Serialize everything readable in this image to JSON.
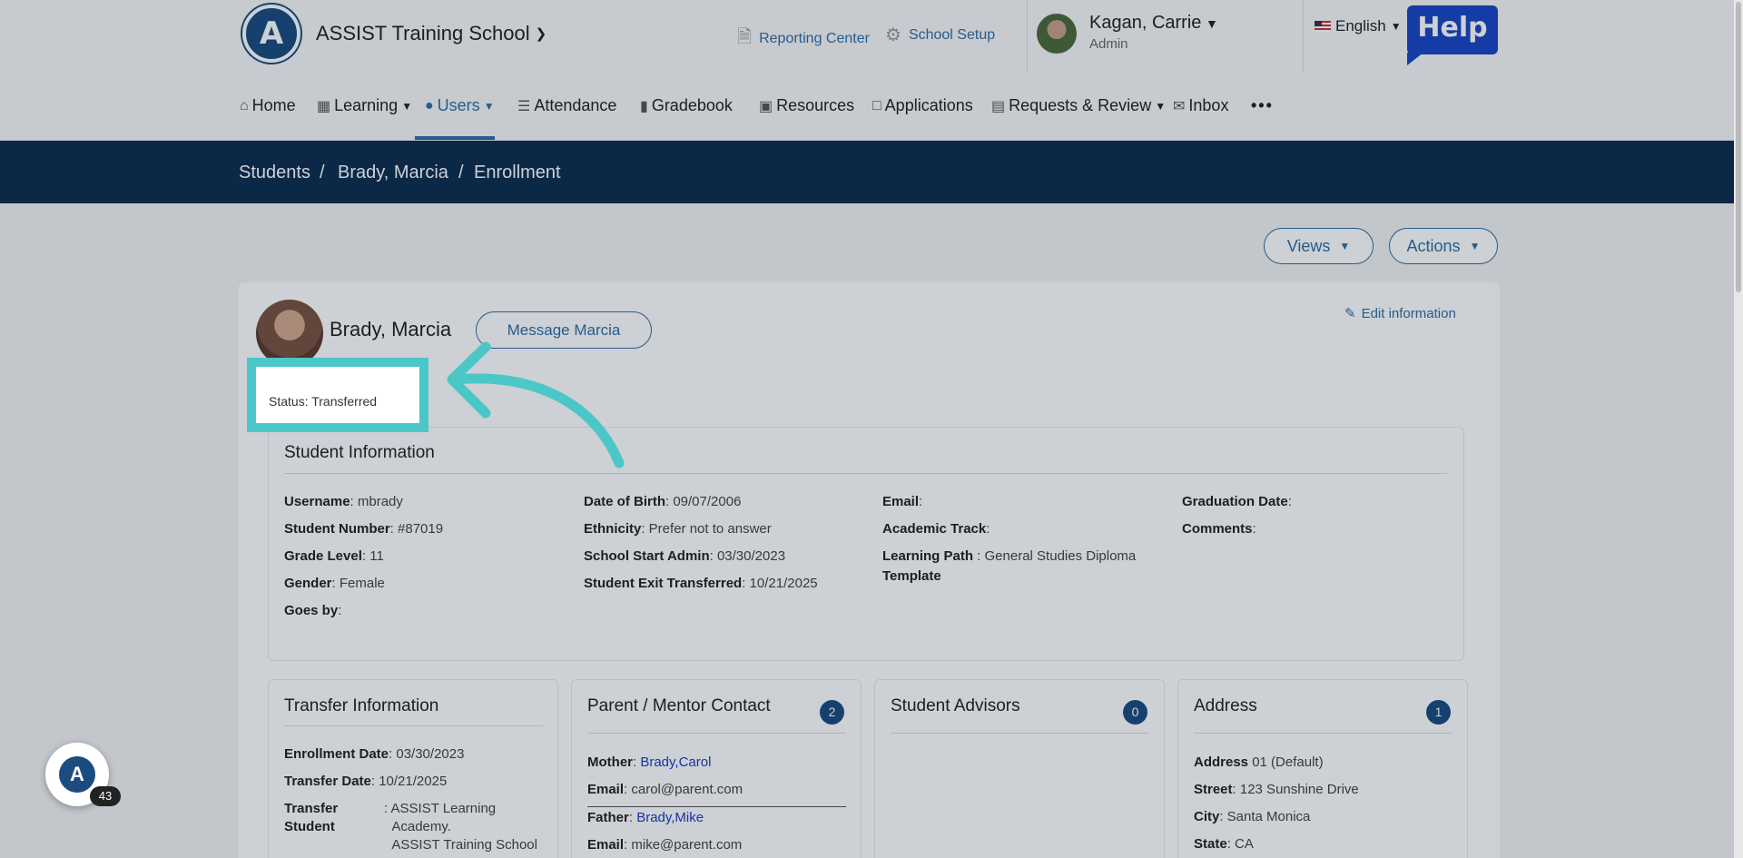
{
  "header": {
    "logo_letter": "A",
    "school_name": "ASSIST Training School",
    "reporting_center": "Reporting Center",
    "school_setup": "School Setup",
    "user_name": "Kagan, Carrie",
    "user_role": "Admin",
    "language": "English",
    "help": "Help"
  },
  "nav": {
    "items": [
      {
        "label": "Home",
        "icon": "home-icon"
      },
      {
        "label": "Learning",
        "icon": "learning-icon"
      },
      {
        "label": "Users",
        "icon": "user-icon"
      },
      {
        "label": "Attendance",
        "icon": "attendance-icon"
      },
      {
        "label": "Gradebook",
        "icon": "gradebook-icon"
      },
      {
        "label": "Resources",
        "icon": "resources-icon"
      },
      {
        "label": "Applications",
        "icon": "applications-icon"
      },
      {
        "label": "Requests & Review",
        "icon": "requests-icon"
      },
      {
        "label": "Inbox",
        "icon": "inbox-icon"
      }
    ],
    "more": "•••"
  },
  "breadcrumb": {
    "students": "Students",
    "sep": "/",
    "student": "Brady, Marcia",
    "page": "Enrollment"
  },
  "toolbar": {
    "views": "Views",
    "actions": "Actions"
  },
  "profile": {
    "name": "Brady, Marcia",
    "message_button": "Message Marcia",
    "edit": "Edit information",
    "status": "Status: Transferred"
  },
  "student_info": {
    "title": "Student Information",
    "col1": [
      {
        "k": "Username",
        "v": ": mbrady"
      },
      {
        "k": "Student Number",
        "v": ": #87019"
      },
      {
        "k": "Grade Level",
        "v": ": 11"
      },
      {
        "k": "Gender",
        "v": ": Female"
      },
      {
        "k": "Goes by",
        "v": ":"
      }
    ],
    "col2": [
      {
        "k": "Date of Birth",
        "v": ": 09/07/2006"
      },
      {
        "k": "Ethnicity",
        "v": ": Prefer not to answer"
      },
      {
        "k": "School Start Admin",
        "v": ": 03/30/2023"
      },
      {
        "k": "Student Exit Transferred",
        "v": ": 10/21/2025"
      }
    ],
    "col3": [
      {
        "k": "Email",
        "v": ":"
      },
      {
        "k": "Academic Track",
        "v": ":"
      },
      {
        "k": "Learning Path",
        "v": " : General Studies Diploma"
      },
      {
        "k": "Template",
        "v": ""
      }
    ],
    "col4": [
      {
        "k": "Graduation Date",
        "v": ":"
      },
      {
        "k": "Comments",
        "v": ":"
      }
    ]
  },
  "transfer": {
    "title": "Transfer Information",
    "enroll_k": "Enrollment Date",
    "enroll_v": ": 03/30/2023",
    "transfer_k": "Transfer Date",
    "transfer_v": ": 10/21/2025",
    "ts_k1": "Transfer",
    "ts_k2": "Student",
    "ts_v1": ": ASSIST Learning",
    "ts_v2": "Academy.",
    "ts_v3": "ASSIST Training School"
  },
  "parent": {
    "title": "Parent / Mentor Contact",
    "count": "2",
    "mother_k": "Mother",
    "mother_v": "Brady,Carol",
    "email1_k": "Email",
    "email1_v": ": carol@parent.com",
    "father_k": "Father",
    "father_v": "Brady,Mike",
    "email2_k": "Email",
    "email2_v": ": mike@parent.com"
  },
  "advisors": {
    "title": "Student Advisors",
    "count": "0"
  },
  "address": {
    "title": "Address",
    "count": "1",
    "addr_k": "Address",
    "addr_v": " 01 (Default)",
    "street_k": "Street",
    "street_v": ": 123 Sunshine Drive",
    "city_k": "City",
    "city_v": ": Santa Monica",
    "state_k": "State",
    "state_v": ": CA"
  },
  "chat": {
    "letter": "A",
    "count": "43"
  },
  "colors": {
    "accent": "#2f6fa5",
    "breadcrumb_bg": "#0d2d4f",
    "highlight": "#4bc7c8",
    "badge": "#1b4c80"
  }
}
